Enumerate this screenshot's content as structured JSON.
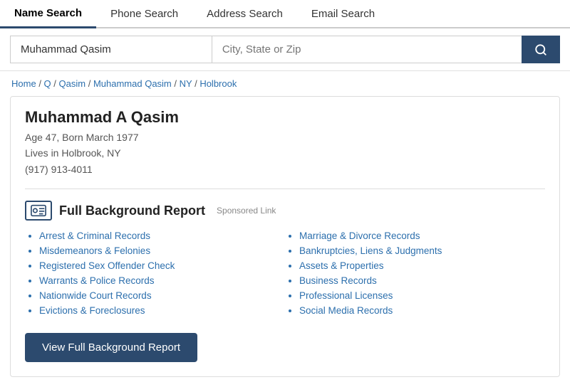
{
  "tabs": [
    {
      "label": "Name Search",
      "active": true
    },
    {
      "label": "Phone Search",
      "active": false
    },
    {
      "label": "Address Search",
      "active": false
    },
    {
      "label": "Email Search",
      "active": false
    }
  ],
  "search": {
    "name_value": "Muhammad Qasim",
    "location_placeholder": "City, State or Zip",
    "button_icon": "🔍"
  },
  "breadcrumb": {
    "items": [
      "Home",
      "Q",
      "Qasim",
      "Muhammad Qasim",
      "NY",
      "Holbrook"
    ]
  },
  "profile": {
    "name": "Muhammad A Qasim",
    "age_line": "Age 47, Born March 1977",
    "location": "Lives in Holbrook, NY",
    "phone": "(917) 913-4011"
  },
  "report": {
    "title": "Full Background Report",
    "sponsored": "Sponsored Link",
    "left_items": [
      "Arrest & Criminal Records",
      "Misdemeanors & Felonies",
      "Registered Sex Offender Check",
      "Warrants & Police Records",
      "Nationwide Court Records",
      "Evictions & Foreclosures"
    ],
    "right_items": [
      "Marriage & Divorce Records",
      "Bankruptcies, Liens & Judgments",
      "Assets & Properties",
      "Business Records",
      "Professional Licenses",
      "Social Media Records"
    ],
    "button_label": "View Full Background Report"
  }
}
